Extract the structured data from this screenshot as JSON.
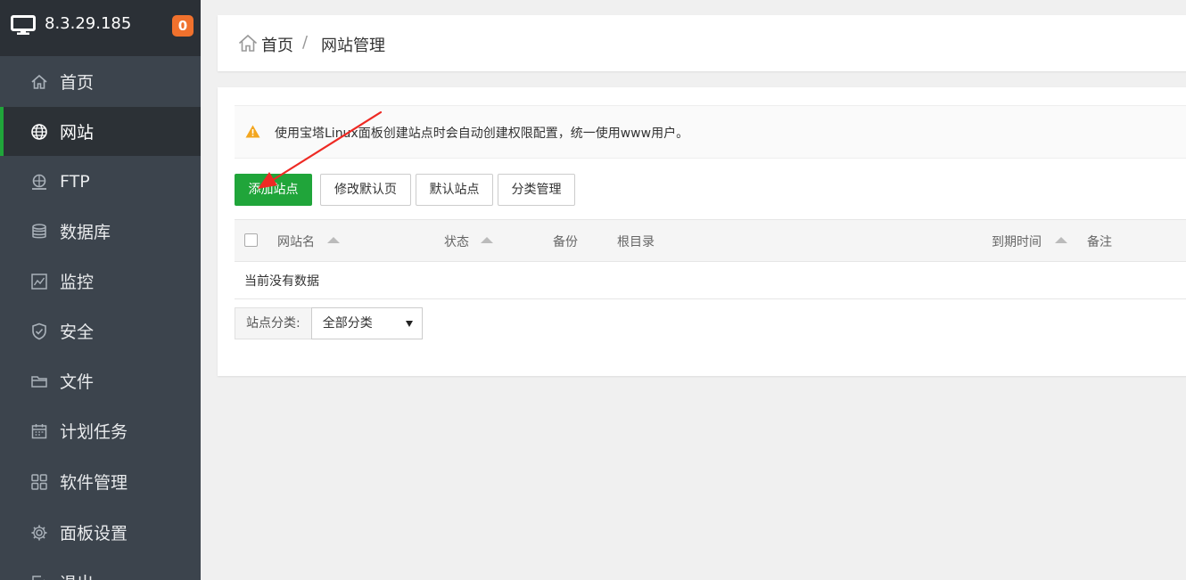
{
  "server": {
    "ip": "8.3.29.185",
    "badge_count": "0"
  },
  "sidebar": {
    "items": [
      {
        "label": "首页",
        "icon": "home-icon"
      },
      {
        "label": "网站",
        "icon": "globe-icon",
        "active": true
      },
      {
        "label": "FTP",
        "icon": "ftp-icon"
      },
      {
        "label": "数据库",
        "icon": "database-icon"
      },
      {
        "label": "监控",
        "icon": "monitor-icon"
      },
      {
        "label": "安全",
        "icon": "shield-icon"
      },
      {
        "label": "文件",
        "icon": "folder-icon"
      },
      {
        "label": "计划任务",
        "icon": "calendar-icon"
      },
      {
        "label": "软件管理",
        "icon": "grid-icon"
      },
      {
        "label": "面板设置",
        "icon": "gear-icon"
      },
      {
        "label": "退出",
        "icon": "logout-icon"
      }
    ]
  },
  "breadcrumb": {
    "home": "首页",
    "separator": "/",
    "current": "网站管理"
  },
  "notice": {
    "text": "使用宝塔Linux面板创建站点时会自动创建权限配置，统一使用www用户。"
  },
  "toolbar": {
    "add_site": "添加站点",
    "modify_default_page": "修改默认页",
    "default_site": "默认站点",
    "category_manage": "分类管理"
  },
  "table": {
    "columns": [
      "网站名",
      "状态",
      "备份",
      "根目录",
      "到期时间",
      "备注"
    ],
    "empty_text": "当前没有数据"
  },
  "filter": {
    "label": "站点分类:",
    "selected": "全部分类"
  },
  "colors": {
    "accent": "#20a53a",
    "badge": "#f0712d",
    "sidebar_bg": "#3c444d",
    "annotation_arrow": "#ee2a24"
  }
}
